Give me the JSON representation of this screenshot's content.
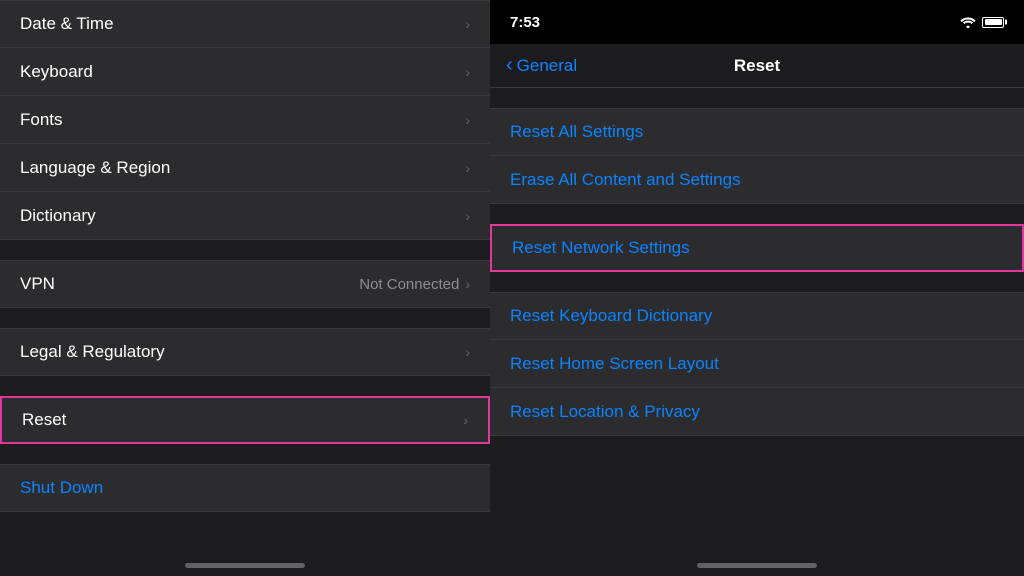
{
  "left": {
    "items_group1": [
      {
        "label": "Date & Time",
        "value": "",
        "id": "date-time"
      },
      {
        "label": "Keyboard",
        "value": "",
        "id": "keyboard"
      },
      {
        "label": "Fonts",
        "value": "",
        "id": "fonts"
      },
      {
        "label": "Language & Region",
        "value": "",
        "id": "language-region"
      },
      {
        "label": "Dictionary",
        "value": "",
        "id": "dictionary"
      }
    ],
    "items_group2": [
      {
        "label": "VPN",
        "value": "Not Connected",
        "id": "vpn"
      }
    ],
    "items_group3": [
      {
        "label": "Legal & Regulatory",
        "value": "",
        "id": "legal"
      }
    ],
    "items_group4": [
      {
        "label": "Reset",
        "value": "",
        "id": "reset",
        "highlighted": true
      }
    ],
    "shutdown_label": "Shut Down"
  },
  "right": {
    "status": {
      "time": "7:53"
    },
    "nav": {
      "back_label": "General",
      "title": "Reset"
    },
    "reset_items_group1": [
      {
        "label": "Reset All Settings",
        "id": "reset-all-settings"
      },
      {
        "label": "Erase All Content and Settings",
        "id": "erase-all-content"
      }
    ],
    "reset_items_group2": [
      {
        "label": "Reset Network Settings",
        "id": "reset-network-settings",
        "highlighted": true
      }
    ],
    "reset_items_group3": [
      {
        "label": "Reset Keyboard Dictionary",
        "id": "reset-keyboard-dict"
      },
      {
        "label": "Reset Home Screen Layout",
        "id": "reset-home-screen"
      },
      {
        "label": "Reset Location & Privacy",
        "id": "reset-location-privacy"
      }
    ]
  }
}
